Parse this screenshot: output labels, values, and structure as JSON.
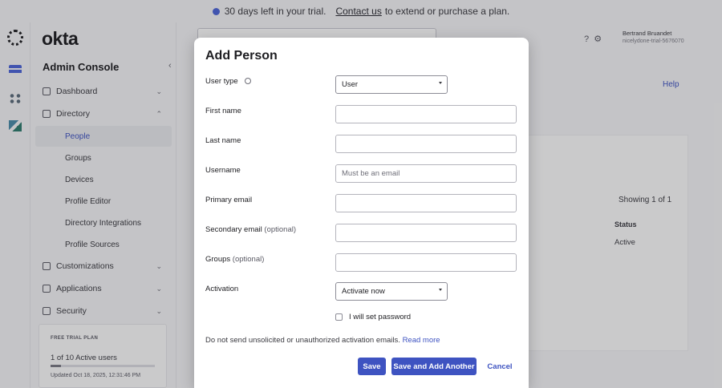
{
  "banner": {
    "text_before": "30 days left in your trial.",
    "contact_link": "Contact us",
    "text_after": "to extend or purchase a plan."
  },
  "brand": {
    "logo_text": "okta"
  },
  "sidebar": {
    "title": "Admin Console",
    "items": [
      {
        "label": "Dashboard",
        "icon": "home-icon"
      },
      {
        "label": "Directory",
        "icon": "people-icon"
      },
      {
        "label": "Customizations",
        "icon": "brush-icon"
      },
      {
        "label": "Applications",
        "icon": "apps-icon"
      },
      {
        "label": "Security",
        "icon": "shield-icon"
      }
    ],
    "directory_sub": [
      {
        "label": "People",
        "active": true
      },
      {
        "label": "Groups"
      },
      {
        "label": "Devices"
      },
      {
        "label": "Profile Editor"
      },
      {
        "label": "Directory Integrations"
      },
      {
        "label": "Profile Sources"
      }
    ]
  },
  "trial_card": {
    "badge": "FREE TRIAL PLAN",
    "users": "1 of 10 Active users",
    "progress": 0.1,
    "updated": "Updated Oct 18, 2025, 12:31:46 PM"
  },
  "header": {
    "user_name": "Bertrand Bruandet",
    "org": "nicelydone-trial-5676070"
  },
  "page": {
    "help": "Help",
    "showing": "Showing 1 of 1",
    "status_header": "Status",
    "status_value": "Active"
  },
  "modal": {
    "title": "Add Person",
    "user_type_label": "User type",
    "user_type_value": "User",
    "first_name_label": "First name",
    "last_name_label": "Last name",
    "username_label": "Username",
    "username_placeholder": "Must be an email",
    "primary_email_label": "Primary email",
    "secondary_email_label": "Secondary email",
    "optional": "(optional)",
    "groups_label": "Groups",
    "activation_label": "Activation",
    "activation_value": "Activate now",
    "password_checkbox_label": "I will set password",
    "disclaimer": "Do not send unsolicited or unauthorized activation emails.",
    "read_more": "Read more",
    "save": "Save",
    "save_another": "Save and Add Another",
    "cancel": "Cancel"
  },
  "colors": {
    "accent": "#3e53c1",
    "overlay": "rgba(29,29,33,0.22)"
  }
}
